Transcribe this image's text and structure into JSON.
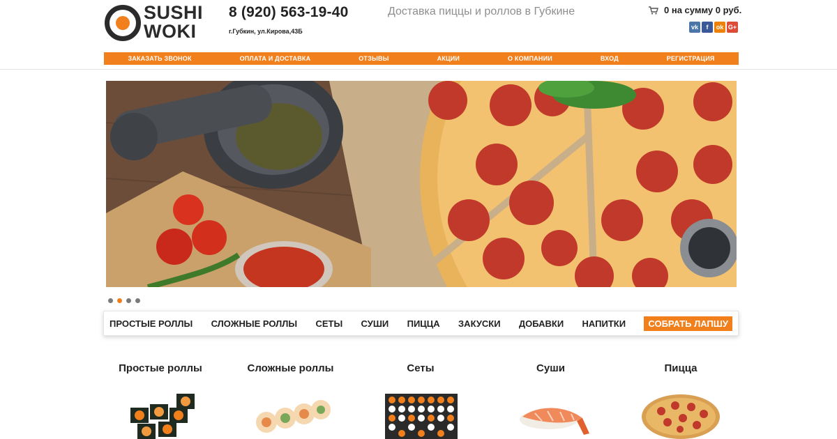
{
  "header": {
    "logo_line1": "SUSHI",
    "logo_line2": "WOKI",
    "phone": "8 (920) 563-19-40",
    "address": "г.Губкин, ул.Кирова,43Б",
    "tagline": "Доставка пиццы и роллов в Губкине",
    "cart_text": "0 на сумму 0 руб.",
    "social": [
      {
        "name": "vk",
        "label": "vk"
      },
      {
        "name": "facebook",
        "label": "f"
      },
      {
        "name": "odnoklassniki",
        "label": "ok"
      },
      {
        "name": "google-plus",
        "label": "G+"
      }
    ]
  },
  "topnav": [
    "ЗАКАЗАТЬ ЗВОНОК",
    "ОПЛАТА И ДОСТАВКА",
    "ОТЗЫВЫ",
    "АКЦИИ",
    "О КОМПАНИИ",
    "ВХОД",
    "РЕГИСТРАЦИЯ"
  ],
  "slider": {
    "slide_count": 4,
    "active_index": 1
  },
  "categories": [
    "ПРОСТЫЕ РОЛЛЫ",
    "СЛОЖНЫЕ РОЛЛЫ",
    "СЕТЫ",
    "СУШИ",
    "ПИЦЦА",
    "ЗАКУСКИ",
    "ДОБАВКИ",
    "НАПИТКИ",
    "СОБРАТЬ ЛАПШУ"
  ],
  "tiles": [
    {
      "title": "Простые роллы"
    },
    {
      "title": "Сложные роллы"
    },
    {
      "title": "Сеты"
    },
    {
      "title": "Суши"
    },
    {
      "title": "Пицца"
    }
  ],
  "colors": {
    "accent": "#f07f1c",
    "dark": "#2b2b2b"
  },
  "icons": {
    "cart": "cart-icon"
  }
}
